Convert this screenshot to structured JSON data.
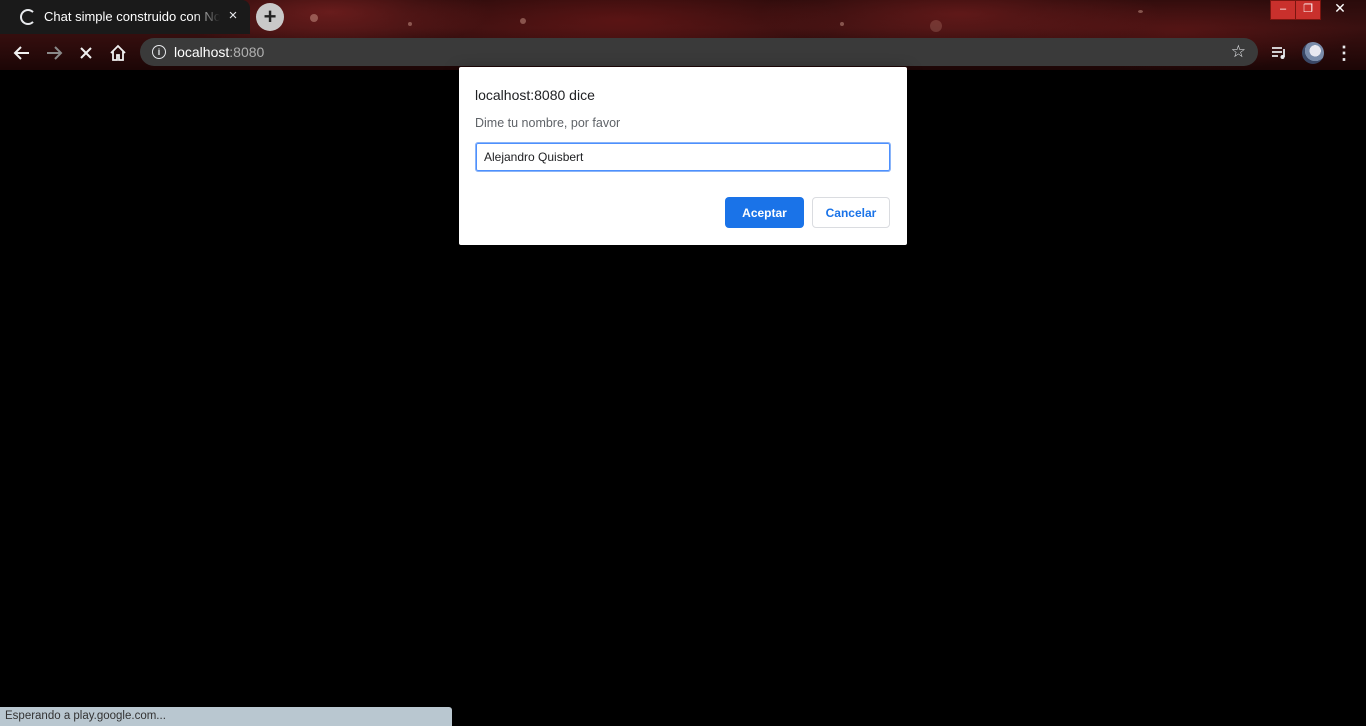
{
  "tab": {
    "title": "Chat simple construido con Node",
    "close_icon": "×",
    "new_tab_icon": "+"
  },
  "window": {
    "minimize_icon": "–",
    "restore_icon": "❐",
    "close_icon": "✕"
  },
  "toolbar": {
    "back_icon": "arrow-left-icon",
    "forward_icon": "arrow-right-icon",
    "stop_icon": "stop-x-icon",
    "home_icon": "home-icon",
    "url_host": "localhost",
    "url_port": ":8080",
    "bookmark_icon": "☆",
    "menu_icon": "⋮"
  },
  "dialog": {
    "title": "localhost:8080 dice",
    "message": "Dime tu nombre, por favor",
    "input_value": "Alejandro Quisbert",
    "ok_label": "Aceptar",
    "cancel_label": "Cancelar"
  },
  "status": {
    "text": "Esperando a play.google.com..."
  },
  "colors": {
    "accent": "#1a73e8",
    "page_bg": "#000000"
  }
}
